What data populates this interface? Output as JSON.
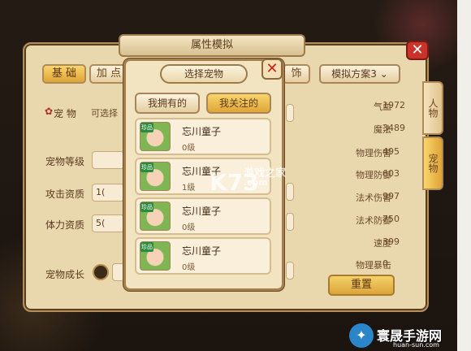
{
  "window": {
    "title": "属性模拟",
    "scheme_select": "模拟方案3"
  },
  "tabs": [
    {
      "label": "基 础",
      "active": true
    },
    {
      "label": "加 点",
      "active": false
    },
    {
      "label": "饰",
      "active": false
    }
  ],
  "side_tabs": [
    "人物",
    "宠物"
  ],
  "left_form": {
    "pet_label": "宠 物",
    "pet_hint": "可选择",
    "fields": [
      {
        "label": "宠物等级",
        "value": ""
      },
      {
        "label": "攻击资质",
        "value": "1("
      },
      {
        "label": "体力资质",
        "value": "5("
      },
      {
        "label": "宠物成长",
        "value": ""
      }
    ]
  },
  "stats": [
    {
      "label": "气血",
      "value": "1972"
    },
    {
      "label": "魔法",
      "value": "3489"
    },
    {
      "label": "物理伤害",
      "value": "495"
    },
    {
      "label": "物理防御",
      "value": "603"
    },
    {
      "label": "法术伤害",
      "value": "997"
    },
    {
      "label": "法术防御",
      "value": "750"
    },
    {
      "label": "速度",
      "value": "399"
    },
    {
      "label": "物理暴击",
      "value": "0"
    }
  ],
  "reset_label": "重置",
  "popup": {
    "title": "选择宠物",
    "tabs": [
      {
        "label": "我拥有的",
        "active": false
      },
      {
        "label": "我关注的",
        "active": true
      }
    ],
    "items": [
      {
        "badge": "珍品",
        "name": "忘川童子",
        "level": "0级"
      },
      {
        "badge": "珍品",
        "name": "忘川童子",
        "level": "1级"
      },
      {
        "badge": "珍品",
        "name": "忘川童子",
        "level": "0级"
      },
      {
        "badge": "珍品",
        "name": "忘川童子",
        "level": "0级"
      }
    ]
  },
  "watermark": {
    "logo": "K73",
    "text": "游戏之家",
    "url": ".com"
  },
  "brand": {
    "name": "寰晟手游网",
    "url": "huan-sun.com"
  },
  "colors": {
    "panel": "#e9d7ae",
    "accent": "#e0a437",
    "close": "#c9332a"
  }
}
